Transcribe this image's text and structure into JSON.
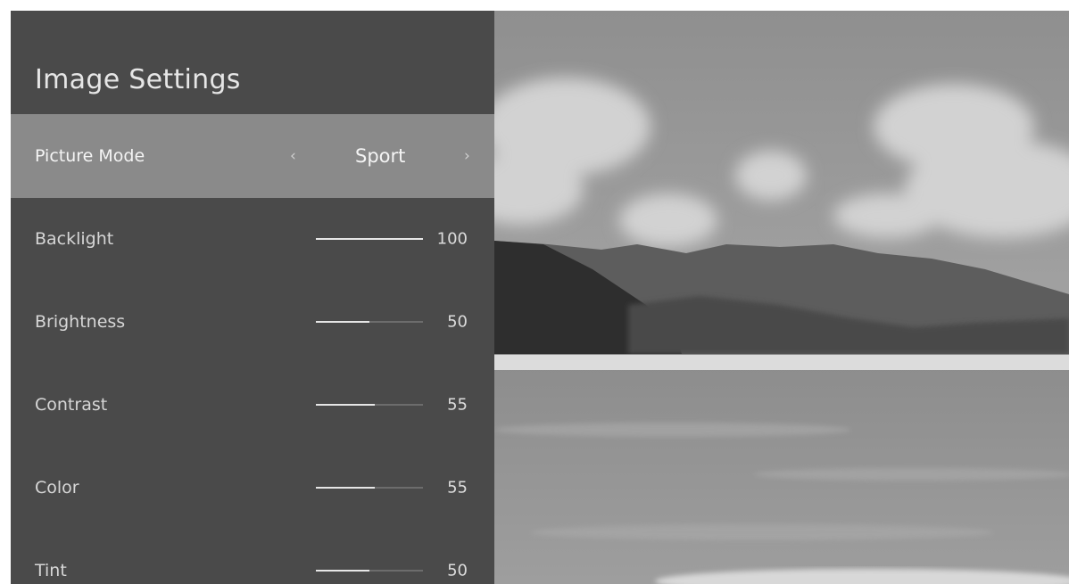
{
  "panel": {
    "title": "Image Settings",
    "picture_mode": {
      "label": "Picture Mode",
      "value": "Sport",
      "prev_icon": "chevron-left-icon",
      "next_icon": "chevron-right-icon"
    },
    "settings": [
      {
        "label": "Backlight",
        "value": "100",
        "level": 100,
        "max": 100
      },
      {
        "label": "Brightness",
        "value": "50",
        "level": 50,
        "max": 100
      },
      {
        "label": "Contrast",
        "value": "55",
        "level": 55,
        "max": 100
      },
      {
        "label": "Color",
        "value": "55",
        "level": 55,
        "max": 100
      },
      {
        "label": "Tint",
        "value": "50",
        "level": 50,
        "max": 100
      }
    ]
  },
  "preview": {
    "subject": "lake-landscape-photo"
  },
  "colors": {
    "panel_bg": "#4a4a4a",
    "selected_row_bg": "#8a8a8a",
    "slider_fill": "#e6e6e6",
    "slider_track": "#6c6c6c"
  }
}
